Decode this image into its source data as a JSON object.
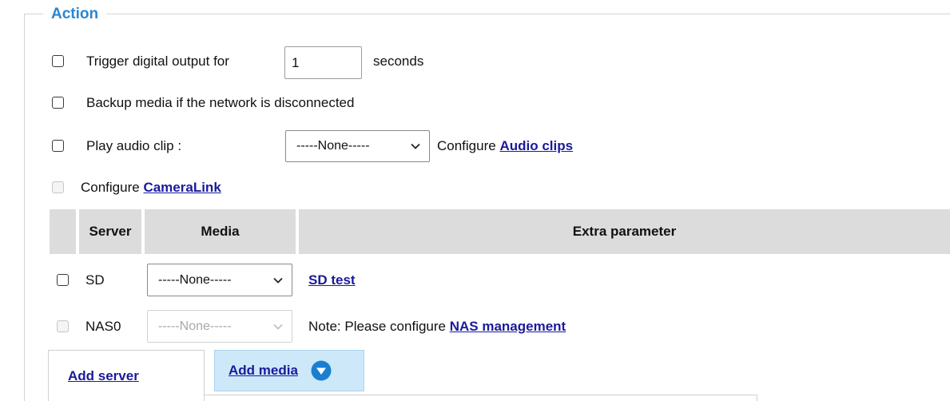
{
  "section": {
    "legend": "Action"
  },
  "actions": {
    "trigger": {
      "label": "Trigger digital output for",
      "value": "1",
      "unit": "seconds",
      "checked": false
    },
    "backup": {
      "label": "Backup media if the network is disconnected",
      "checked": false
    },
    "audio": {
      "label": "Play audio clip :",
      "select_value": "-----None-----",
      "configure_text": "Configure",
      "configure_link": "Audio clips",
      "checked": false
    },
    "cameralink": {
      "configure_text": "Configure",
      "link": "CameraLink",
      "disabled": true
    }
  },
  "table": {
    "headers": [
      "Server",
      "Media",
      "Extra parameter"
    ],
    "rows": [
      {
        "server": "SD",
        "media": "-----None-----",
        "extra_link": "SD test",
        "disabled": false
      },
      {
        "server": "NAS0",
        "media": "-----None-----",
        "note": "Note: Please configure",
        "note_link": "NAS management",
        "disabled": true
      }
    ]
  },
  "tabs": {
    "add_server": "Add server",
    "add_media": "Add media"
  },
  "colors": {
    "legend": "#2a86d1",
    "link": "#1a1a9c",
    "header_bg": "#dcdcdc",
    "tab_active_bg": "#cde8f8",
    "dropdown_icon": "#1a7fd1"
  }
}
